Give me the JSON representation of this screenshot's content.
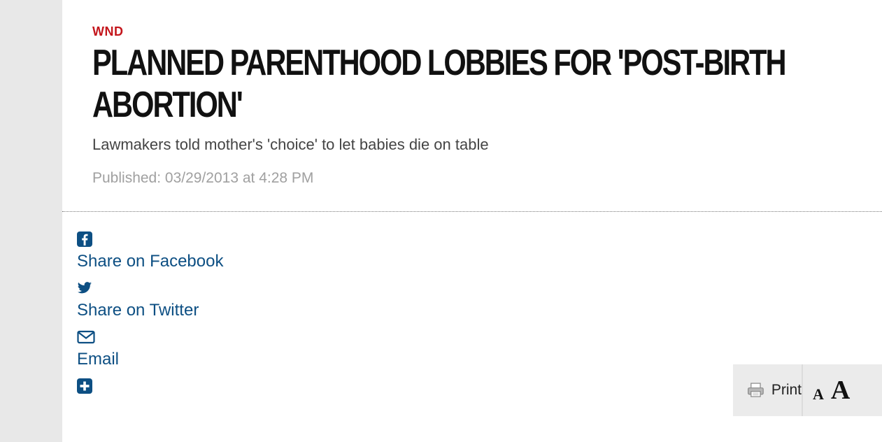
{
  "article": {
    "brand": "WND",
    "headline": "PLANNED PARENTHOOD LOBBIES FOR 'POST-BIRTH ABORTION'",
    "subheadline": "Lawmakers told mother's 'choice' to let babies die on table",
    "published": "Published: 03/29/2013 at 4:28 PM"
  },
  "share": {
    "facebook": {
      "icon": "facebook-square-icon",
      "label": "Share on Facebook"
    },
    "twitter": {
      "icon": "twitter-bird-icon",
      "label": "Share on Twitter"
    },
    "email": {
      "icon": "envelope-icon",
      "label": "Email"
    },
    "more": {
      "icon": "plus-square-icon"
    }
  },
  "tools": {
    "print_label": "Print",
    "print_icon": "printer-icon",
    "font_small": "A",
    "font_large": "A"
  },
  "colors": {
    "brand": "#c4161c",
    "link": "#0d4f83",
    "rail": "#e8e8e8",
    "toolbar": "#ebebeb"
  }
}
